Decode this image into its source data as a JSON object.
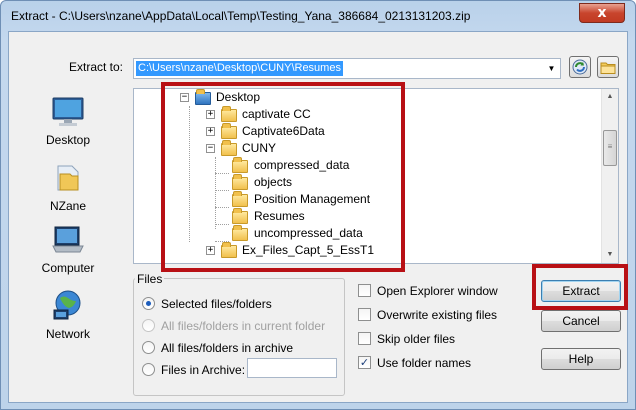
{
  "window": {
    "title": "Extract - C:\\Users\\nzane\\AppData\\Local\\Temp\\Testing_Yana_386684_0213131203.zip",
    "close_glyph": "x"
  },
  "extract_to": {
    "label": "Extract to:",
    "value": "C:\\Users\\nzane\\Desktop\\CUNY\\Resumes",
    "dropdown_icon": "chevron-down-icon",
    "dropdown_glyph": "▼"
  },
  "toolbar": {
    "refresh_icon": "refresh-icon",
    "new_folder_icon": "new-folder-icon"
  },
  "places": [
    {
      "label": "Desktop",
      "icon": "desktop-icon"
    },
    {
      "label": "NZane",
      "icon": "user-folder-icon"
    },
    {
      "label": "Computer",
      "icon": "computer-icon"
    },
    {
      "label": "Network",
      "icon": "network-icon"
    }
  ],
  "tree": {
    "items": [
      {
        "label": "Desktop",
        "level": 0,
        "expander": "−"
      },
      {
        "label": "captivate CC",
        "level": 1,
        "expander": "+"
      },
      {
        "label": "Captivate6Data",
        "level": 1,
        "expander": "+"
      },
      {
        "label": "CUNY",
        "level": 1,
        "expander": "−"
      },
      {
        "label": "compressed_data",
        "level": 2,
        "expander": ""
      },
      {
        "label": "objects",
        "level": 2,
        "expander": ""
      },
      {
        "label": "Position Management",
        "level": 2,
        "expander": ""
      },
      {
        "label": "Resumes",
        "level": 2,
        "expander": ""
      },
      {
        "label": "uncompressed_data",
        "level": 2,
        "expander": ""
      },
      {
        "label": "Ex_Files_Capt_5_EssT1",
        "level": 1,
        "expander": "+"
      }
    ],
    "scroll_up_glyph": "▲",
    "scroll_down_glyph": "▼",
    "scroll_thumb_glyph": "≡"
  },
  "files_group": {
    "legend": "Files",
    "options": [
      {
        "label": "Selected files/folders",
        "checked": true,
        "disabled": false
      },
      {
        "label": "All files/folders in current folder",
        "checked": false,
        "disabled": true
      },
      {
        "label": "All files/folders in archive",
        "checked": false,
        "disabled": false
      },
      {
        "label": "Files in Archive:",
        "checked": false,
        "disabled": false
      }
    ],
    "files_in_archive_value": ""
  },
  "checkboxes": [
    {
      "label": "Open Explorer window",
      "checked": false
    },
    {
      "label": "Overwrite existing files",
      "checked": false
    },
    {
      "label": "Skip older files",
      "checked": false
    },
    {
      "label": "Use folder names",
      "checked": true
    }
  ],
  "check_glyph": "✓",
  "buttons": {
    "extract": "Extract",
    "cancel": "Cancel",
    "help": "Help"
  },
  "highlight_color": "#b81015"
}
